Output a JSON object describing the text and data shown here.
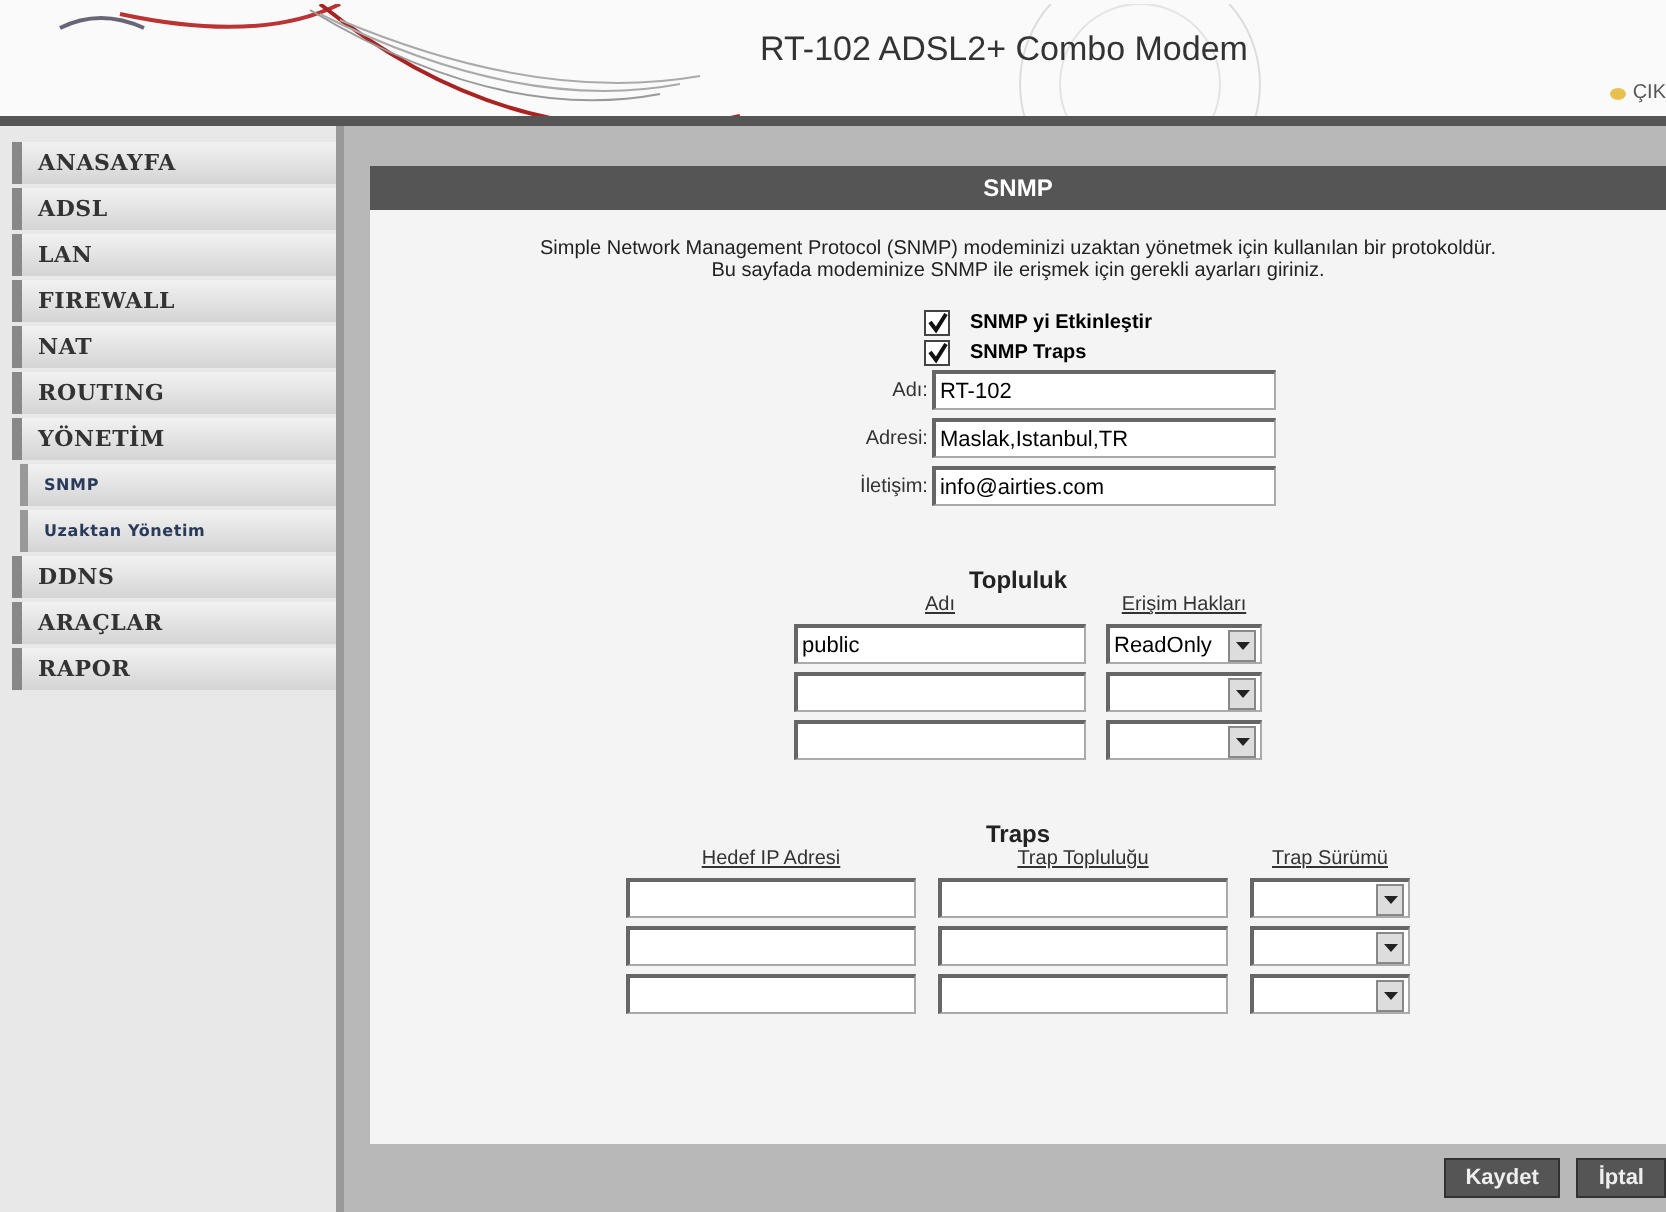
{
  "header": {
    "title": "RT-102 ADSL2+ Combo Modem",
    "logout": "ÇIK"
  },
  "sidebar": {
    "items": [
      {
        "label": "ANASAYFA",
        "kind": "main"
      },
      {
        "label": "ADSL",
        "kind": "main"
      },
      {
        "label": "LAN",
        "kind": "main"
      },
      {
        "label": "FIREWALL",
        "kind": "main"
      },
      {
        "label": "NAT",
        "kind": "main"
      },
      {
        "label": "ROUTING",
        "kind": "main"
      },
      {
        "label": "YÖNETİM",
        "kind": "main"
      },
      {
        "label": "SNMP",
        "kind": "sub"
      },
      {
        "label": "Uzaktan Yönetim",
        "kind": "sub"
      },
      {
        "label": "DDNS",
        "kind": "main"
      },
      {
        "label": "ARAÇLAR",
        "kind": "main"
      },
      {
        "label": "RAPOR",
        "kind": "main"
      }
    ]
  },
  "panel": {
    "title": "SNMP",
    "intro": [
      "Simple Network Management Protocol (SNMP) modeminizi uzaktan yönetmek için kullanılan bir protokoldür.",
      "Bu sayfada modeminize SNMP ile erişmek için gerekli ayarları giriniz."
    ],
    "checkboxes": [
      {
        "label": "SNMP yi Etkinleştir",
        "checked": true
      },
      {
        "label": "SNMP Traps",
        "checked": true
      }
    ],
    "fields": [
      {
        "label": "Adı:",
        "value": "RT-102"
      },
      {
        "label": "Adresi:",
        "value": "Maslak,Istanbul,TR"
      },
      {
        "label": "İletişim:",
        "value": "info@airties.com"
      }
    ],
    "community": {
      "title": "Topluluk",
      "columns": [
        "Adı",
        "Erişim Hakları"
      ],
      "rows": [
        {
          "name": "public",
          "access": "ReadOnly"
        },
        {
          "name": "",
          "access": ""
        },
        {
          "name": "",
          "access": ""
        }
      ]
    },
    "traps": {
      "title": "Traps",
      "columns": [
        "Hedef IP Adresi",
        "Trap Topluluğu",
        "Trap Sürümü"
      ],
      "rows": [
        {
          "ip": "",
          "community": "",
          "version": ""
        },
        {
          "ip": "",
          "community": "",
          "version": ""
        },
        {
          "ip": "",
          "community": "",
          "version": ""
        }
      ]
    }
  },
  "buttons": [
    "Kaydet",
    "İptal"
  ]
}
